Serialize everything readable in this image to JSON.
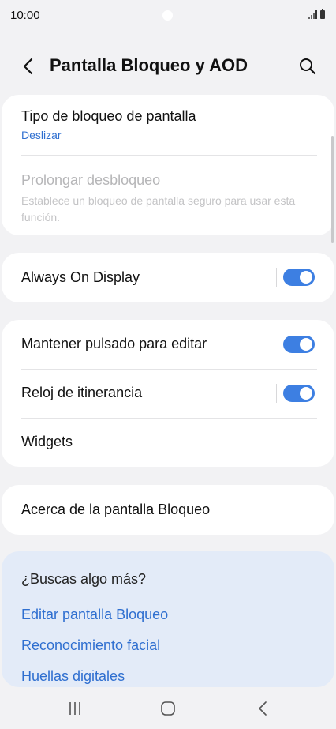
{
  "status_bar": {
    "time": "10:00"
  },
  "header": {
    "title": "Pantalla Bloqueo y AOD"
  },
  "card1": {
    "lock_type": {
      "title": "Tipo de bloqueo de pantalla",
      "value": "Deslizar"
    },
    "extend_unlock": {
      "title": "Prolongar desbloqueo",
      "subtitle": "Establece un bloqueo de pantalla seguro para usar esta función."
    }
  },
  "card2": {
    "aod": {
      "title": "Always On Display",
      "enabled": true
    }
  },
  "card3": {
    "hold_edit": {
      "title": "Mantener pulsado para editar",
      "enabled": true
    },
    "roaming_clock": {
      "title": "Reloj de itinerancia",
      "enabled": true
    },
    "widgets": {
      "title": "Widgets"
    }
  },
  "card4": {
    "about": {
      "title": "Acerca de la pantalla Bloqueo"
    }
  },
  "suggestions": {
    "title": "¿Buscas algo más?",
    "links": [
      "Editar pantalla Bloqueo",
      "Reconocimiento facial",
      "Huellas digitales"
    ]
  },
  "colors": {
    "accent": "#3d7fe2",
    "link": "#2f6fd0",
    "background": "#f2f2f4"
  },
  "icons": {
    "back": "back-arrow-icon",
    "search": "search-icon",
    "recents": "recents-icon",
    "home": "home-icon",
    "nav_back": "nav-back-icon"
  }
}
